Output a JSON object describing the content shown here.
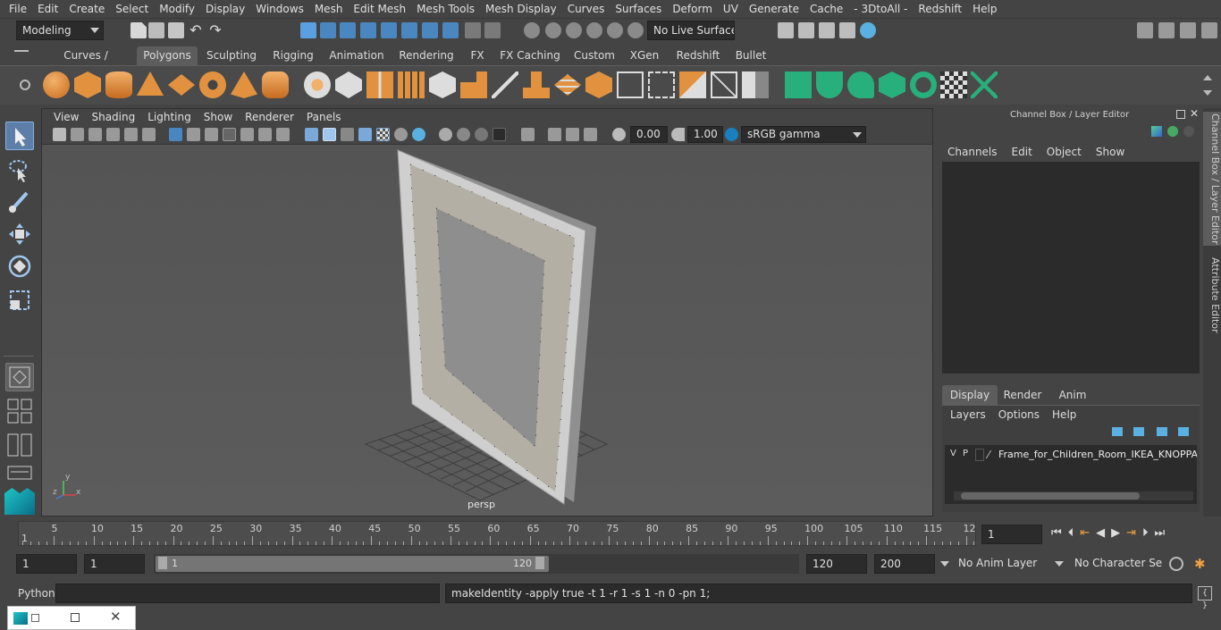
{
  "menu": [
    "File",
    "Edit",
    "Create",
    "Select",
    "Modify",
    "Display",
    "Windows",
    "Mesh",
    "Edit Mesh",
    "Mesh Tools",
    "Mesh Display",
    "Curves",
    "Surfaces",
    "Deform",
    "UV",
    "Generate",
    "Cache",
    "- 3DtoAll -",
    "Redshift",
    "Help"
  ],
  "status": {
    "mode": "Modeling",
    "live_surface": "No Live Surface"
  },
  "shelf_tabs": [
    "Curves / Surfaces",
    "Polygons",
    "Sculpting",
    "Rigging",
    "Animation",
    "Rendering",
    "FX",
    "FX Caching",
    "Custom",
    "XGen",
    "Redshift",
    "Bullet"
  ],
  "shelf_active": "Polygons",
  "viewport": {
    "menu": [
      "View",
      "Shading",
      "Lighting",
      "Show",
      "Renderer",
      "Panels"
    ],
    "exposure": "0.00",
    "gamma": "1.00",
    "colorspace": "sRGB gamma",
    "camera": "persp"
  },
  "channel_box": {
    "title": "Channel Box / Layer Editor",
    "menu": [
      "Channels",
      "Edit",
      "Object",
      "Show"
    ],
    "layer_tabs": [
      "Display",
      "Render",
      "Anim"
    ],
    "layer_active": "Display",
    "layer_menu": [
      "Layers",
      "Options",
      "Help"
    ],
    "layer_row": {
      "v": "V",
      "p": "P",
      "name": "Frame_for_Children_Room_IKEA_KNOPPANG"
    }
  },
  "side_tabs": [
    "Channel Box / Layer Editor",
    "Attribute Editor"
  ],
  "timeline": {
    "labels": [
      "5",
      "10",
      "15",
      "20",
      "25",
      "30",
      "35",
      "40",
      "45",
      "50",
      "55",
      "60",
      "65",
      "70",
      "75",
      "80",
      "85",
      "90",
      "95",
      "100",
      "105",
      "110",
      "115",
      "12"
    ],
    "start_mark": "1",
    "current_frame": "1"
  },
  "range": {
    "start": "1",
    "playback_start": "1",
    "slider_start": "1",
    "slider_end": "120",
    "playback_end": "120",
    "end": "200",
    "anim_layer": "No Anim Layer",
    "char_set": "No Character Set"
  },
  "command": {
    "lang": "Python",
    "result": "makeIdentity -apply true -t 1 -r 1 -s 1 -n 0 -pn 1;"
  }
}
